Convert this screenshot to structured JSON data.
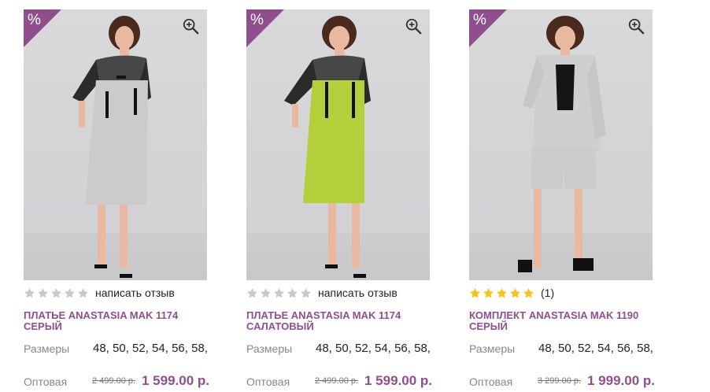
{
  "colors": {
    "accent": "#8e4f8c",
    "star_filled": "#f6c21c",
    "star_empty": "#c9c9c9"
  },
  "products": [
    {
      "badge": "%",
      "rating_stars": 0,
      "rating_text": "написать отзыв",
      "title": "ПЛАТЬЕ ANASTASIA MAK 1174 СЕРЫЙ",
      "sizes_label": "Размеры",
      "sizes": "48, 50, 52, 54, 56, 58,",
      "price_label": "Оптовая",
      "old_price": "2 499.00 р.",
      "new_price": "1 599.00 р."
    },
    {
      "badge": "%",
      "rating_stars": 0,
      "rating_text": "написать отзыв",
      "title": "ПЛАТЬЕ ANASTASIA MAK 1174 САЛАТОВЫЙ",
      "sizes_label": "Размеры",
      "sizes": "48, 50, 52, 54, 56, 58,",
      "price_label": "Оптовая",
      "old_price": "2 499.00 р.",
      "new_price": "1 599.00 р."
    },
    {
      "badge": "%",
      "rating_stars": 5,
      "rating_text": "(1)",
      "title": "КОМПЛЕКТ ANASTASIA MAK 1190 СЕРЫЙ",
      "sizes_label": "Размеры",
      "sizes": "48, 50, 52, 54, 56, 58,",
      "price_label": "Оптовая",
      "old_price": "3 299.00 р.",
      "new_price": "1 999.00 р."
    }
  ]
}
